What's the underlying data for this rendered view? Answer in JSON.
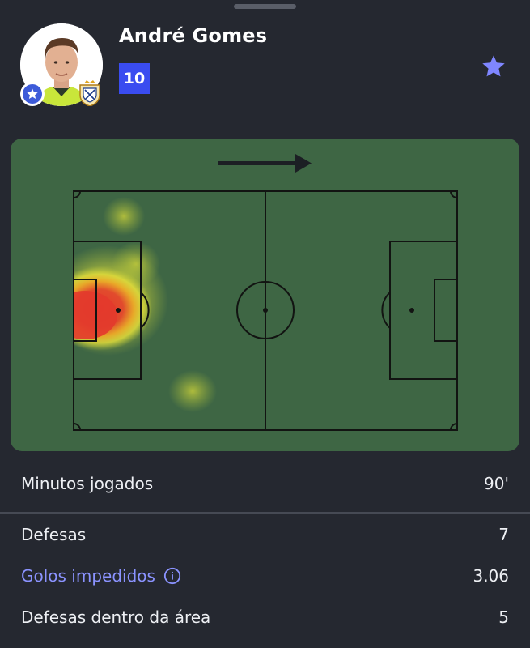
{
  "player": {
    "name": "André Gomes",
    "shirt_number": "10"
  },
  "icons": {
    "favorite_badge": "star-icon",
    "follow": "star-icon",
    "info": "info-icon",
    "direction": "arrow-right-icon",
    "club": "club-crest-icon"
  },
  "colors": {
    "accent": "#3a4cf0",
    "star": "#7f86ff",
    "link": "#8b93ff",
    "pitch": "#3e6644",
    "background": "#252830"
  },
  "heatmap": {
    "attack_direction": "right"
  },
  "stats": [
    {
      "label": "Minutos jogados",
      "value": "90'"
    },
    {
      "label": "Defesas",
      "value": "7"
    },
    {
      "label": "Golos impedidos",
      "value": "3.06",
      "has_info": true
    },
    {
      "label": "Defesas dentro da área",
      "value": "5"
    }
  ]
}
